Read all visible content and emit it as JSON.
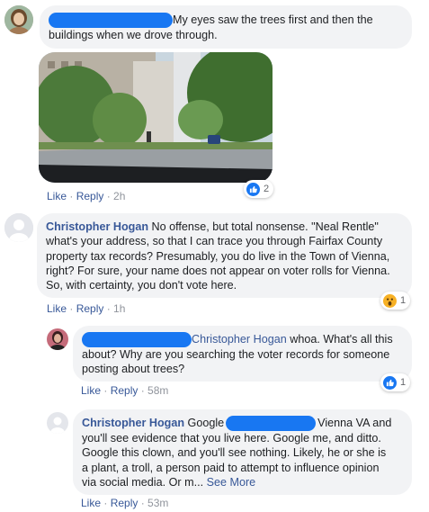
{
  "comments": [
    {
      "author_redacted": true,
      "text": "My eyes saw the trees first and then the buildings when we drove through.",
      "line1": "My eyes saw the trees first and then the",
      "line2": "buildings when we drove through.",
      "actions": {
        "like": "Like",
        "reply": "Reply",
        "time": "2h"
      },
      "reaction": {
        "type": "like",
        "count": "2"
      }
    },
    {
      "author": "Christopher Hogan",
      "lines": [
        " No offense, but total nonsense. \"Neal Rentle\"",
        "what's your address, so that I can trace you through Fairfax County",
        "property tax records? Presumably, you do live in the Town of Vienna,",
        "right? For sure, your name does not appear on voter rolls for Vienna.",
        "So, with certainty, you don't vote here."
      ],
      "actions": {
        "like": "Like",
        "reply": "Reply",
        "time": "1h"
      },
      "reaction": {
        "type": "wow",
        "count": "1"
      }
    },
    {
      "mention": "Christopher Hogan",
      "lines": [
        " whoa. What's all this",
        "about? Why are you searching the voter records for someone",
        "posting about trees?"
      ],
      "actions": {
        "like": "Like",
        "reply": "Reply",
        "time": "58m"
      },
      "reaction": {
        "type": "like",
        "count": "1"
      }
    },
    {
      "author": "Christopher Hogan",
      "line1_pre": " Google",
      "line1_post": "Vienna VA and",
      "lines": [
        "you'll see evidence that you live here. Google me, and ditto.",
        "Google this clown, and you'll see nothing. Likely, he or she is",
        "a plant, a troll, a person paid to attempt to influence opinion"
      ],
      "last_line": "via social media. Or m...",
      "see_more": "See More",
      "actions": {
        "like": "Like",
        "reply": "Reply",
        "time": "53m"
      }
    }
  ],
  "colors": {
    "link": "#385898",
    "redaction": "#1877f2",
    "bubble": "#f2f3f5",
    "like": "#1877f2",
    "wow": "#f7b125"
  },
  "icons": {
    "like": "thumbs-up-icon",
    "wow": "wow-emoji-icon",
    "avatar_default": "default-avatar-icon"
  }
}
